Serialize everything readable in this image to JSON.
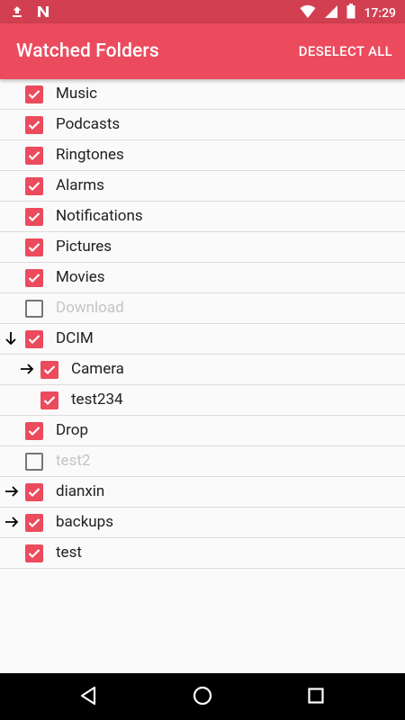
{
  "status_bar": {
    "time": "17:29",
    "icons": [
      "upload-icon",
      "n-icon",
      "wifi-icon",
      "battery-icon"
    ]
  },
  "app_bar": {
    "title": "Watched Folders",
    "action_label": "DESELECT ALL"
  },
  "folders": [
    {
      "name": "Music",
      "checked": true,
      "level": 0,
      "arrow": null
    },
    {
      "name": "Podcasts",
      "checked": true,
      "level": 0,
      "arrow": null
    },
    {
      "name": "Ringtones",
      "checked": true,
      "level": 0,
      "arrow": null
    },
    {
      "name": "Alarms",
      "checked": true,
      "level": 0,
      "arrow": null
    },
    {
      "name": "Notifications",
      "checked": true,
      "level": 0,
      "arrow": null
    },
    {
      "name": "Pictures",
      "checked": true,
      "level": 0,
      "arrow": null
    },
    {
      "name": "Movies",
      "checked": true,
      "level": 0,
      "arrow": null
    },
    {
      "name": "Download",
      "checked": false,
      "level": 0,
      "arrow": null
    },
    {
      "name": "DCIM",
      "checked": true,
      "level": 0,
      "arrow": "down"
    },
    {
      "name": "Camera",
      "checked": true,
      "level": 1,
      "arrow": "right"
    },
    {
      "name": "test234",
      "checked": true,
      "level": 1,
      "arrow": null
    },
    {
      "name": "Drop",
      "checked": true,
      "level": 0,
      "arrow": null
    },
    {
      "name": "test2",
      "checked": false,
      "level": 0,
      "arrow": null
    },
    {
      "name": "dianxin",
      "checked": true,
      "level": 0,
      "arrow": "right"
    },
    {
      "name": "backups",
      "checked": true,
      "level": 0,
      "arrow": "right"
    },
    {
      "name": "test",
      "checked": true,
      "level": 0,
      "arrow": null
    }
  ],
  "nav": {
    "buttons": [
      "back-icon",
      "home-icon",
      "recents-icon"
    ]
  },
  "colors": {
    "accent": "#eb4b5d",
    "status_bar": "#d13f51",
    "checkbox_on": "#eb4b5d",
    "disabled_text": "#c4c4c4"
  }
}
